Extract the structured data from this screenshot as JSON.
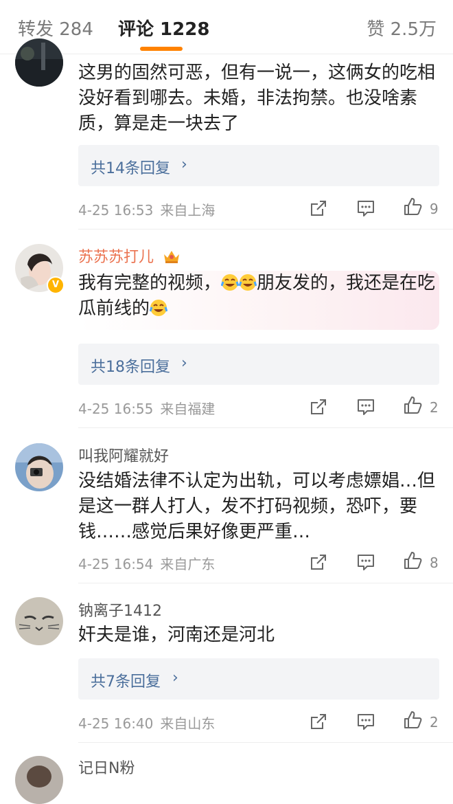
{
  "tabs": {
    "repost": "转发 284",
    "comments": "评论 1228",
    "likes": "赞 2.5万"
  },
  "accent_color": "#ff8200",
  "comments": [
    {
      "username": "",
      "text": "这男的固然可恶，但有一说一，这俩女的吃相没好看到哪去。未婚，非法拘禁。也没啥素质，算是走一块去了",
      "replies": "共14条回复",
      "time": "4-25 16:53",
      "location": "来自上海",
      "likes": "9"
    },
    {
      "username": "苏苏苏打儿",
      "text_before": "我有完整的视频，",
      "text_middle": "朋友发的，我还是在吃瓜前线的",
      "emoji": "crying-laughing-emoji",
      "replies": "共18条回复",
      "time": "4-25 16:55",
      "location": "来自福建",
      "likes": "2"
    },
    {
      "username": "叫我阿耀就好",
      "text": "没结婚法律不认定为出轨，可以考虑嫖娼…但是这一群人打人，发不打码视频，恐吓，要钱……感觉后果好像更严重…",
      "time": "4-25 16:54",
      "location": "来自广东",
      "likes": "8"
    },
    {
      "username": "钠离子1412",
      "text": "奸夫是谁，河南还是河北",
      "replies": "共7条回复",
      "time": "4-25 16:40",
      "location": "来自山东",
      "likes": "2"
    },
    {
      "username": "记日N粉"
    }
  ],
  "icons": {
    "share": "share-icon",
    "comment": "comment-icon",
    "like": "thumbs-up-icon",
    "verified": "verified-badge-icon",
    "vip": "vip-crown-icon",
    "chevron": "chevron-right-icon"
  },
  "chevron": "›"
}
